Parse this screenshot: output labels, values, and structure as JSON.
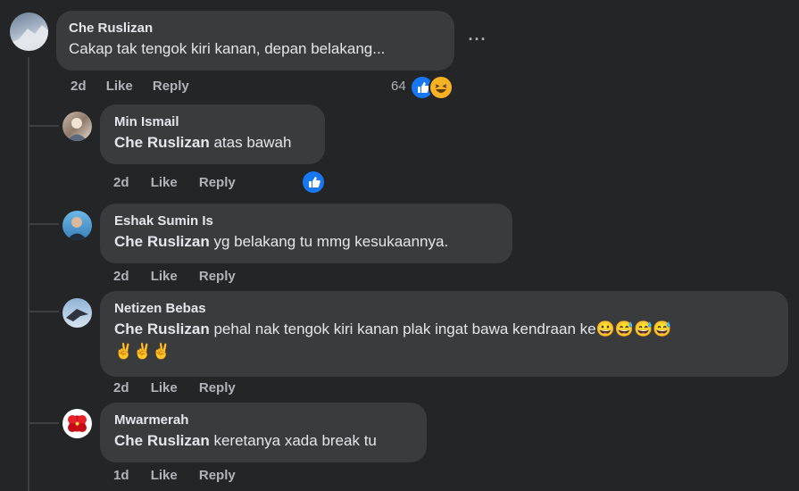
{
  "main_comment": {
    "author": "Che Ruslizan",
    "text": "Cakap tak tengok kiri kanan, depan belakang...",
    "time": "2d",
    "like_label": "Like",
    "reply_label": "Reply",
    "reaction_count": "64",
    "more_icon": "more-options-icon"
  },
  "replies": [
    {
      "author": "Min Ismail",
      "mention": "Che Ruslizan",
      "text": " atas bawah",
      "time": "2d",
      "like_label": "Like",
      "reply_label": "Reply"
    },
    {
      "author": "Eshak Sumin Is",
      "mention": "Che Ruslizan",
      "text": " yg belakang tu mmg kesukaannya.",
      "time": "2d",
      "like_label": "Like",
      "reply_label": "Reply"
    },
    {
      "author": "Netizen Bebas",
      "mention": "Che Ruslizan",
      "text": " pehal nak tengok kiri kanan plak ingat bawa kendraan ke",
      "emoji_line1": "😀😅😅😅",
      "emoji_line2": "✌️✌️✌️",
      "time": "2d",
      "like_label": "Like",
      "reply_label": "Reply"
    },
    {
      "author": "Mwarmerah",
      "mention": "Che Ruslizan",
      "text": " keretanya xada break tu",
      "time": "1d",
      "like_label": "Like",
      "reply_label": "Reply"
    }
  ],
  "colors": {
    "background": "#242526",
    "bubble": "#3a3b3c",
    "meta_text": "#b0b3b8",
    "like_blue": "#1877f2"
  }
}
